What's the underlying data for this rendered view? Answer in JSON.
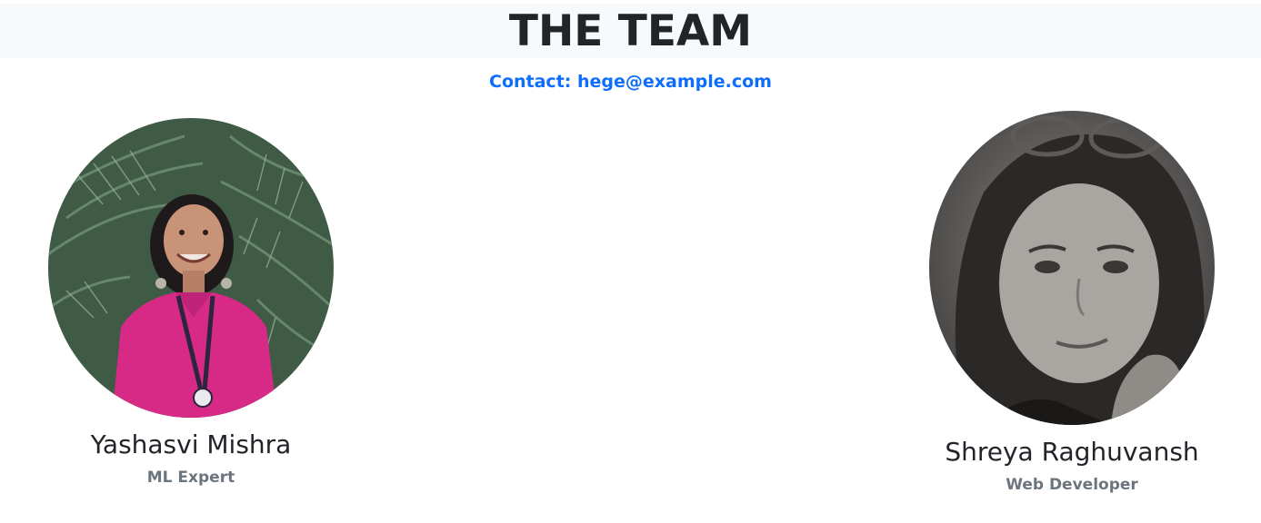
{
  "header": {
    "title": "THE TEAM",
    "contact": "Contact: hege@example.com"
  },
  "members": [
    {
      "name": "Yashasvi Mishra",
      "role": "ML Expert",
      "photo_icon": "portrait-photo-icon"
    },
    {
      "name": "Shreya Raghuvansh",
      "role": "Web Developer",
      "photo_icon": "portrait-photo-icon"
    }
  ],
  "colors": {
    "header_band": "#f8f9fa",
    "contact_link": "#0d6efd",
    "role_text": "#6c757d",
    "title_text": "#212529"
  }
}
